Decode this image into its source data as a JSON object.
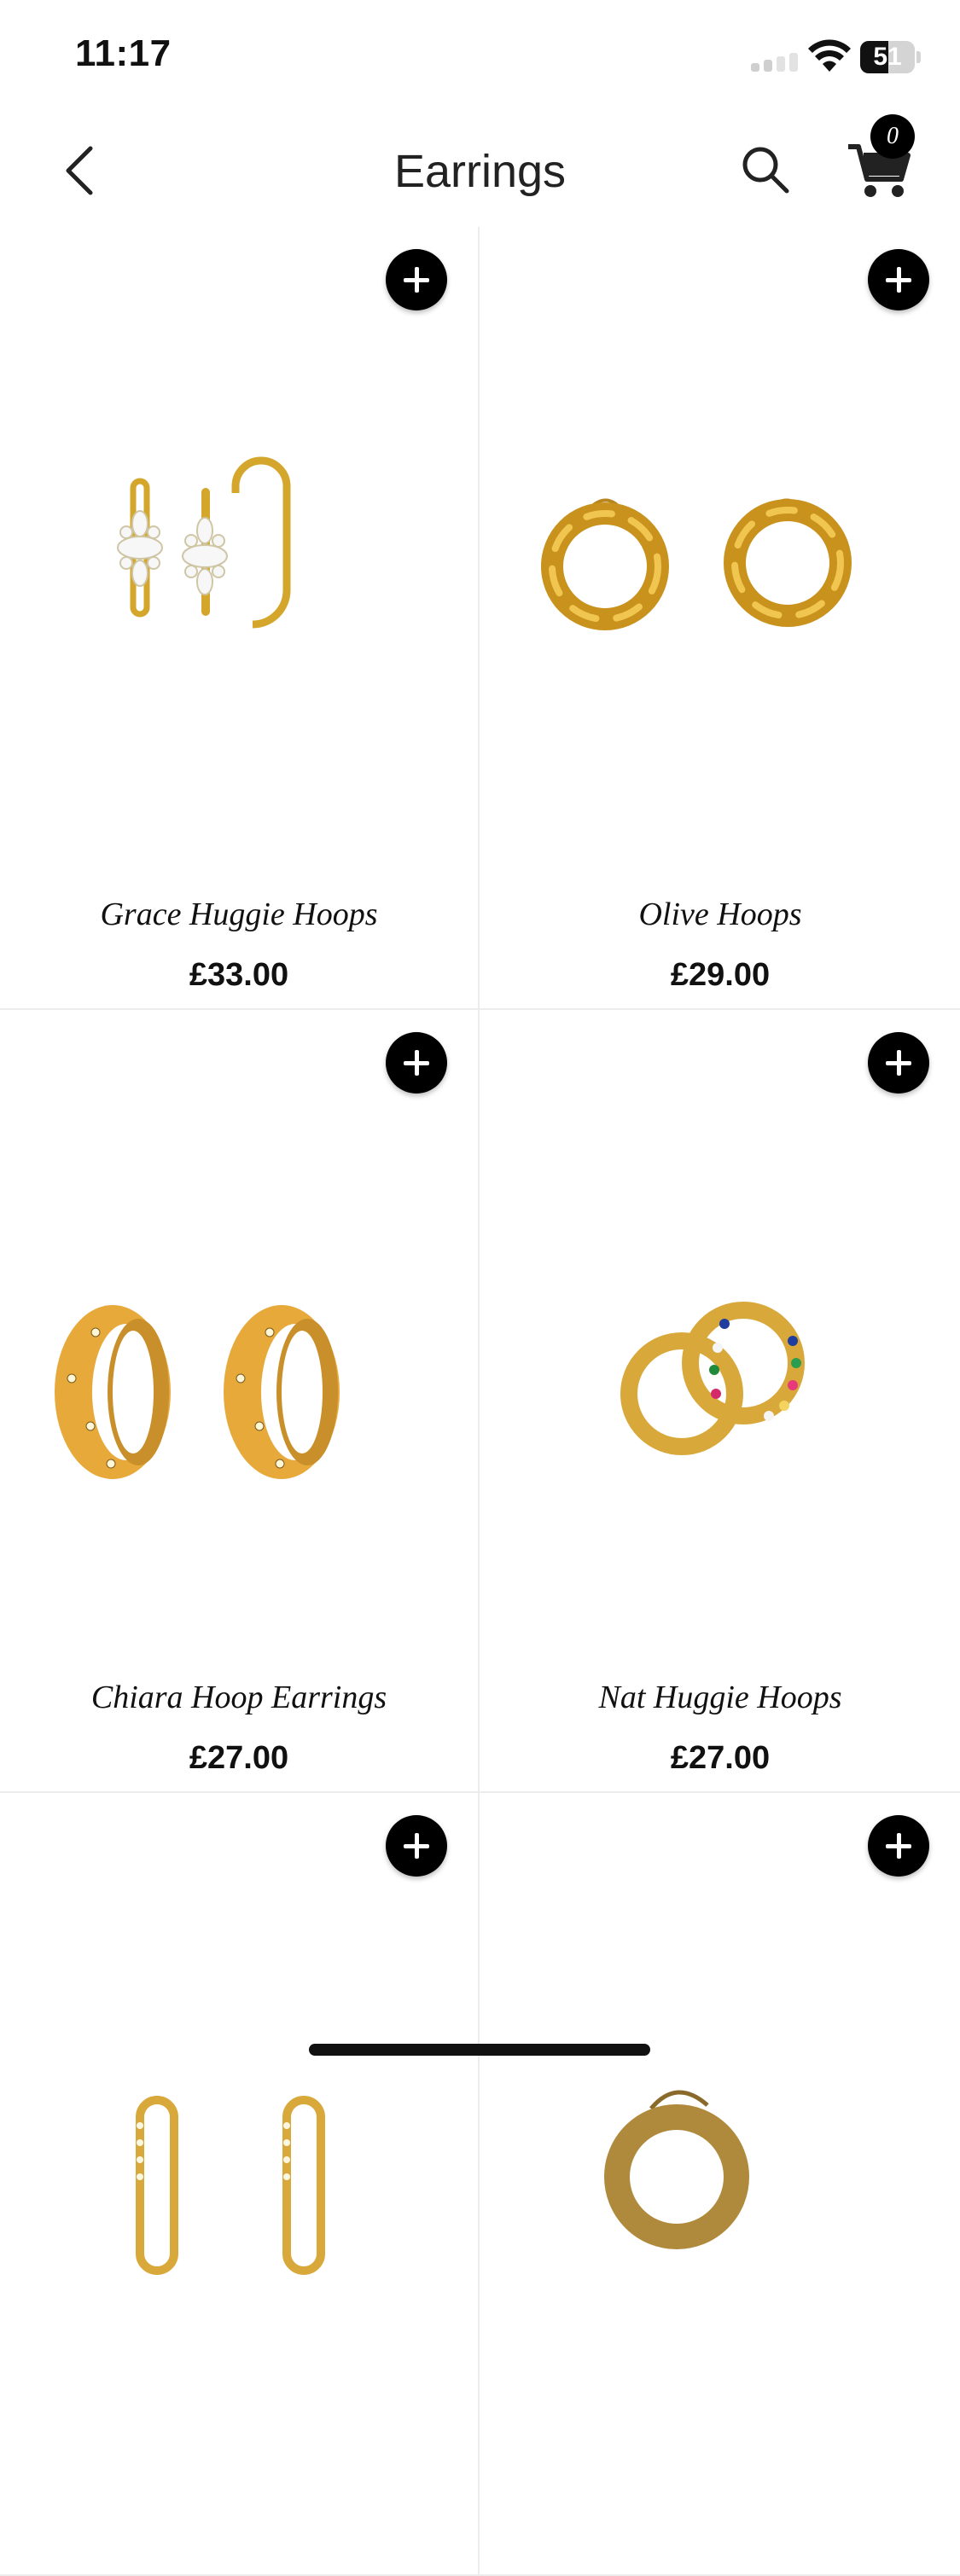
{
  "status_bar": {
    "time": "11:17",
    "battery": "51",
    "battery_level": 0.51
  },
  "nav": {
    "title": "Earrings",
    "cart_count": "0"
  },
  "products": [
    {
      "name": "Grace Huggie Hoops",
      "price": "£33.00"
    },
    {
      "name": "Olive Hoops",
      "price": "£29.00"
    },
    {
      "name": "Chiara Hoop Earrings",
      "price": "£27.00"
    },
    {
      "name": "Nat Huggie Hoops",
      "price": "£27.00"
    },
    {
      "name": "",
      "price": ""
    },
    {
      "name": "",
      "price": ""
    }
  ],
  "colors": {
    "accent": "#000000",
    "gold": "#d4a72c",
    "divider": "#ececec"
  }
}
